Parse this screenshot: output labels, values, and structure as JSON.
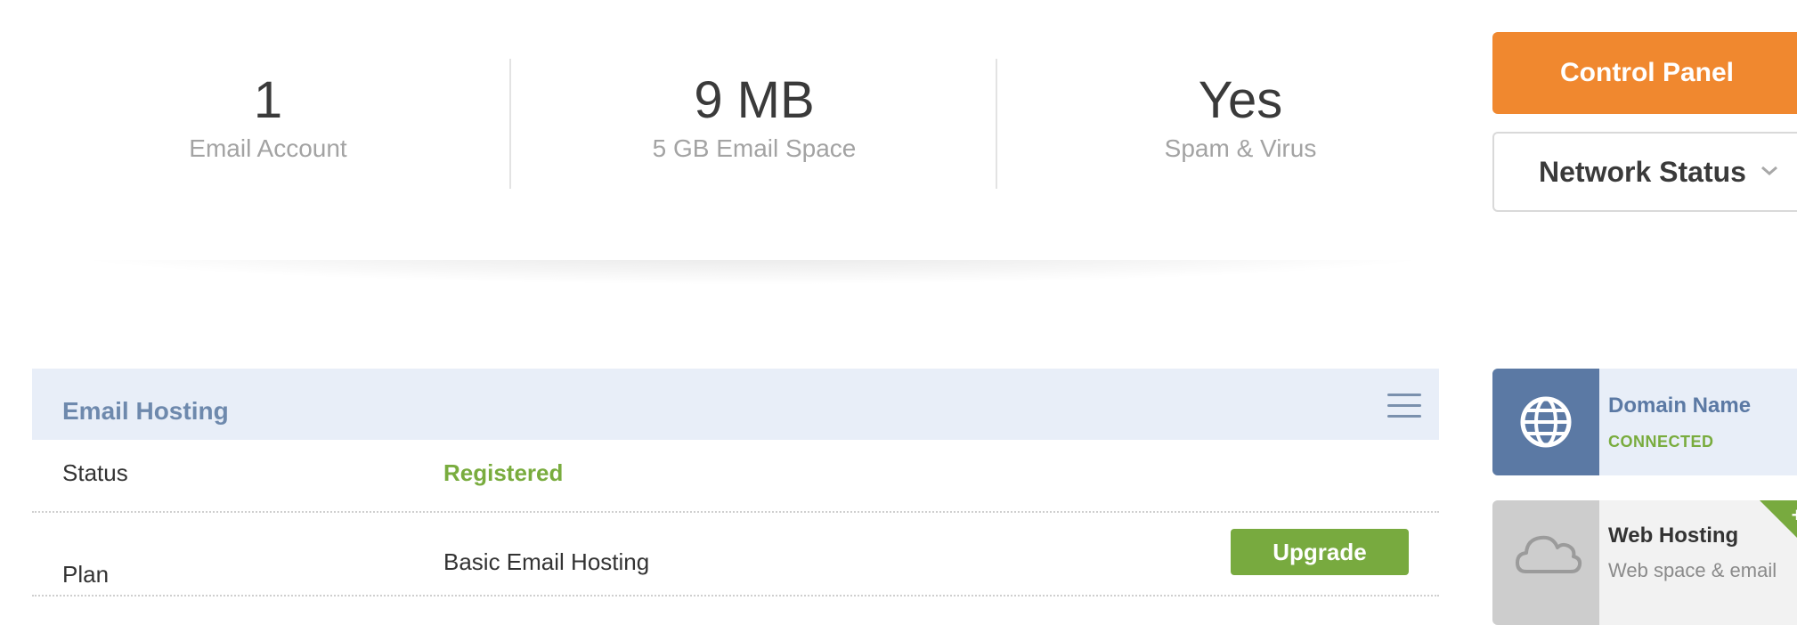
{
  "stats": [
    {
      "value": "1",
      "label": "Email Account"
    },
    {
      "value": "9 MB",
      "label": "5 GB Email Space"
    },
    {
      "value": "Yes",
      "label": "Spam & Virus"
    }
  ],
  "buttons": {
    "control_panel": "Control Panel",
    "network_status": "Network Status"
  },
  "panel": {
    "title": "Email Hosting",
    "rows": [
      {
        "key": "Status",
        "value": "Registered"
      },
      {
        "key": "Plan",
        "value": "Basic Email Hosting",
        "action": "Upgrade"
      }
    ]
  },
  "cards": {
    "domain": {
      "title": "Domain Name",
      "status": "CONNECTED",
      "icon": "globe-icon"
    },
    "web": {
      "title": "Web Hosting",
      "subtitle": "Web space & email",
      "icon": "cloud-icon",
      "badge": "+"
    }
  },
  "colors": {
    "accent_orange": "#f0882f",
    "accent_green": "#78aa3f",
    "accent_blue": "#5b79a4",
    "panel_header_bg": "#e8eef8"
  }
}
